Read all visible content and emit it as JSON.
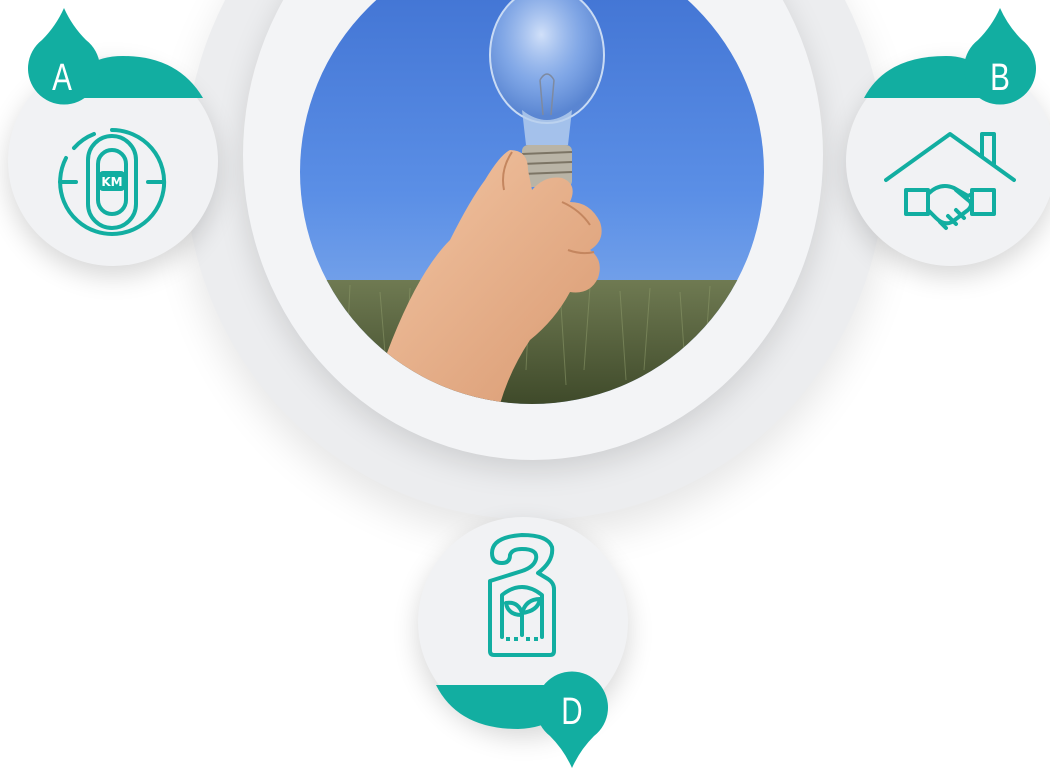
{
  "colors": {
    "accent": "#12aea1",
    "ring_outer": "#ecedef",
    "ring_inner": "#f3f4f6",
    "node_fill": "#f1f2f4"
  },
  "center": {
    "image": "hand-holding-light-bulb-photo"
  },
  "nodes": [
    {
      "id": "A",
      "letter": "A",
      "icon": "odometer-km-icon"
    },
    {
      "id": "B",
      "letter": "B",
      "icon": "house-handshake-icon"
    },
    {
      "id": "D",
      "letter": "D",
      "icon": "eco-door-hanger-icon"
    }
  ]
}
